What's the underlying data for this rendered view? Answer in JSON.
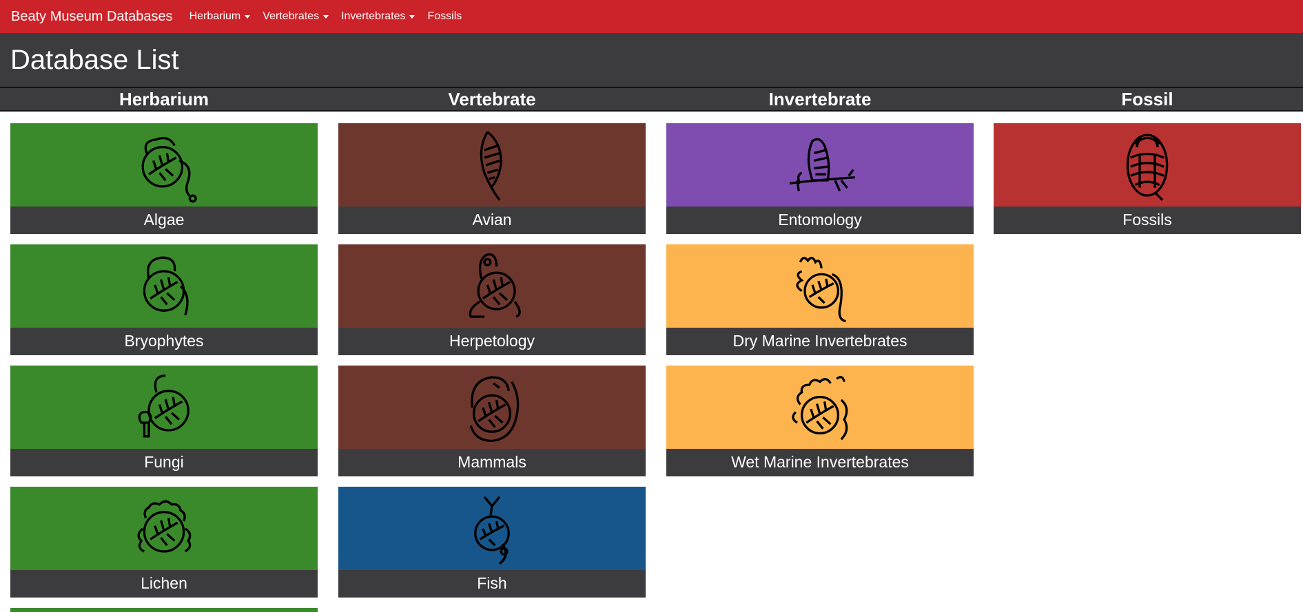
{
  "nav": {
    "brand": "Beaty Museum Databases",
    "items": [
      {
        "label": "Herbarium",
        "dropdown": true
      },
      {
        "label": "Vertebrates",
        "dropdown": true
      },
      {
        "label": "Invertebrates",
        "dropdown": true
      },
      {
        "label": "Fossils",
        "dropdown": false
      }
    ]
  },
  "page": {
    "title": "Database List"
  },
  "columns": [
    {
      "heading": "Herbarium"
    },
    {
      "heading": "Vertebrate"
    },
    {
      "heading": "Invertebrate"
    },
    {
      "heading": "Fossil"
    }
  ],
  "cards": {
    "herbarium": [
      {
        "label": "Algae",
        "icon": "algae-icon",
        "color": "#3a8a2c"
      },
      {
        "label": "Bryophytes",
        "icon": "bryophyte-icon",
        "color": "#3a8a2c"
      },
      {
        "label": "Fungi",
        "icon": "mushroom-icon",
        "color": "#3a8a2c"
      },
      {
        "label": "Lichen",
        "icon": "lichen-icon",
        "color": "#3a8a2c"
      }
    ],
    "vertebrate": [
      {
        "label": "Avian",
        "icon": "feather-icon",
        "color": "#6e372e"
      },
      {
        "label": "Herpetology",
        "icon": "frog-icon",
        "color": "#6e372e"
      },
      {
        "label": "Mammals",
        "icon": "mammal-icon",
        "color": "#6e372e"
      },
      {
        "label": "Fish",
        "icon": "fish-icon",
        "color": "#17568a"
      }
    ],
    "invertebrate": [
      {
        "label": "Entomology",
        "icon": "butterfly-icon",
        "color": "#7f4db0"
      },
      {
        "label": "Dry Marine Invertebrates",
        "icon": "shell-icon",
        "color": "#fdb44e"
      },
      {
        "label": "Wet Marine Invertebrates",
        "icon": "sea-slug-icon",
        "color": "#fdb44e"
      }
    ],
    "fossil": [
      {
        "label": "Fossils",
        "icon": "trilobite-icon",
        "color": "#b83232"
      }
    ]
  },
  "colors": {
    "navbar": "#cc2229",
    "dark": "#3c3c3e",
    "herbarium_green": "#3a8a2c"
  }
}
